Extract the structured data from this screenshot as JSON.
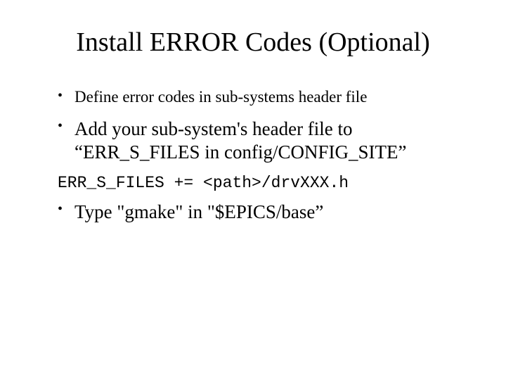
{
  "title": "Install ERROR Codes (Optional)",
  "bullets": {
    "b1": "Define error codes in sub-systems header file",
    "b2": "Add your sub-system's header file to “ERR_S_FILES in config/CONFIG_SITE”",
    "b3": "Type \"gmake\" in \"$EPICS/base”"
  },
  "code": "ERR_S_FILES += <path>/drvXXX.h"
}
